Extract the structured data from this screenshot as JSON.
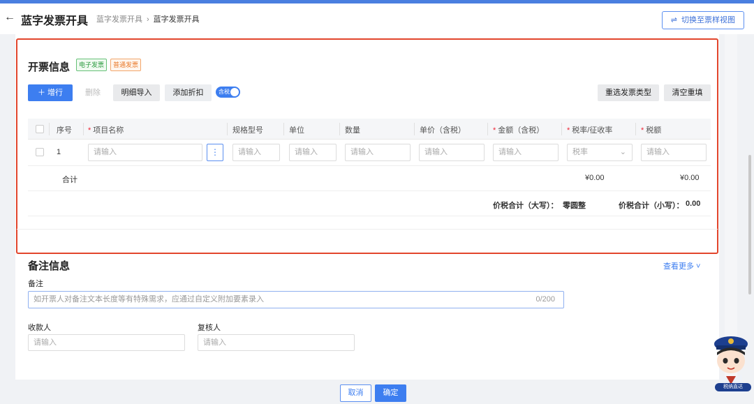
{
  "header": {
    "back_icon": "arrow-left-icon",
    "title": "蓝字发票开具",
    "breadcrumb": [
      "蓝字发票开具",
      "蓝字发票开具"
    ],
    "switch_view_label": "切换至票样视图"
  },
  "invoice_info": {
    "title": "开票信息",
    "tags": [
      "电子发票",
      "普通发票"
    ],
    "toolbar": {
      "add_row": "增行",
      "delete": "删除",
      "import_details": "明细导入",
      "add_discount": "添加折扣",
      "tax_included_toggle": "含税",
      "reselect_type": "重选发票类型",
      "clear_refill": "清空重填"
    },
    "table": {
      "headers": [
        "序号",
        "项目名称",
        "规格型号",
        "单位",
        "数量",
        "单价（含税）",
        "金额（含税）",
        "税率/征收率",
        "税额"
      ],
      "row": {
        "index": "1",
        "placeholder": "请输入",
        "tax_rate_placeholder": "税率"
      },
      "sum_label": "合计",
      "sum_amount": "¥0.00",
      "sum_tax": "¥0.00"
    },
    "total": {
      "upper_label": "价税合计（大写）：",
      "upper_value": "零圆整",
      "lower_label": "价税合计（小写）：",
      "lower_value": "0.00"
    }
  },
  "remarks": {
    "title": "备注信息",
    "more_link": "查看更多",
    "remark_label": "备注",
    "remark_placeholder": "如开票人对备注文本长度等有特殊需求，应通过自定义附加要素录入",
    "remark_counter": "0/200",
    "payee_label": "收款人",
    "reviewer_label": "复核人",
    "placeholder": "请输入"
  },
  "footer": {
    "cancel": "取消",
    "confirm": "确定"
  },
  "mascot": {
    "label": "税纳直达"
  },
  "colors": {
    "primary": "#3d7ef0",
    "highlight_border": "#e2452c"
  }
}
